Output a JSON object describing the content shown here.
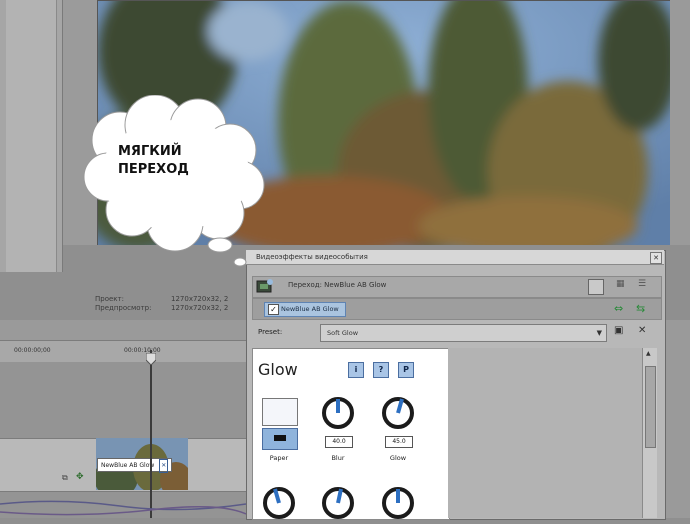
{
  "preview": {
    "info_labels": [
      "Проект:",
      "Предпросмотр:"
    ],
    "info_values": [
      "1270x720x32, 2",
      "1270x720x32, 2"
    ]
  },
  "timeline": {
    "ruler_labels": [
      "00:00:00;00",
      "00:00:10;00"
    ],
    "clip_label": "NewBlue AB Glow"
  },
  "callout": {
    "text_line1": "МЯГКИЙ",
    "text_line2": "ПЕРЕХОД"
  },
  "dialog": {
    "title": "Видеоэффекты видеособытия",
    "chain_label": "Переход: NewBlue AB Glow",
    "plugin_label": "NewBlue AB Glow",
    "preset_label": "Preset:",
    "preset_value": "Soft Glow",
    "panel": {
      "heading": "Glow",
      "buttons": [
        "i",
        "?",
        "P"
      ],
      "controls": [
        {
          "name": "Paper",
          "value": ""
        },
        {
          "name": "Blur",
          "value": "40.0"
        },
        {
          "name": "Glow",
          "value": "45.0"
        }
      ]
    }
  },
  "colors": {
    "accent": "#a9c5e6",
    "dialog_bg": "#b8b8b8",
    "panel_bg": "#ffffff"
  }
}
